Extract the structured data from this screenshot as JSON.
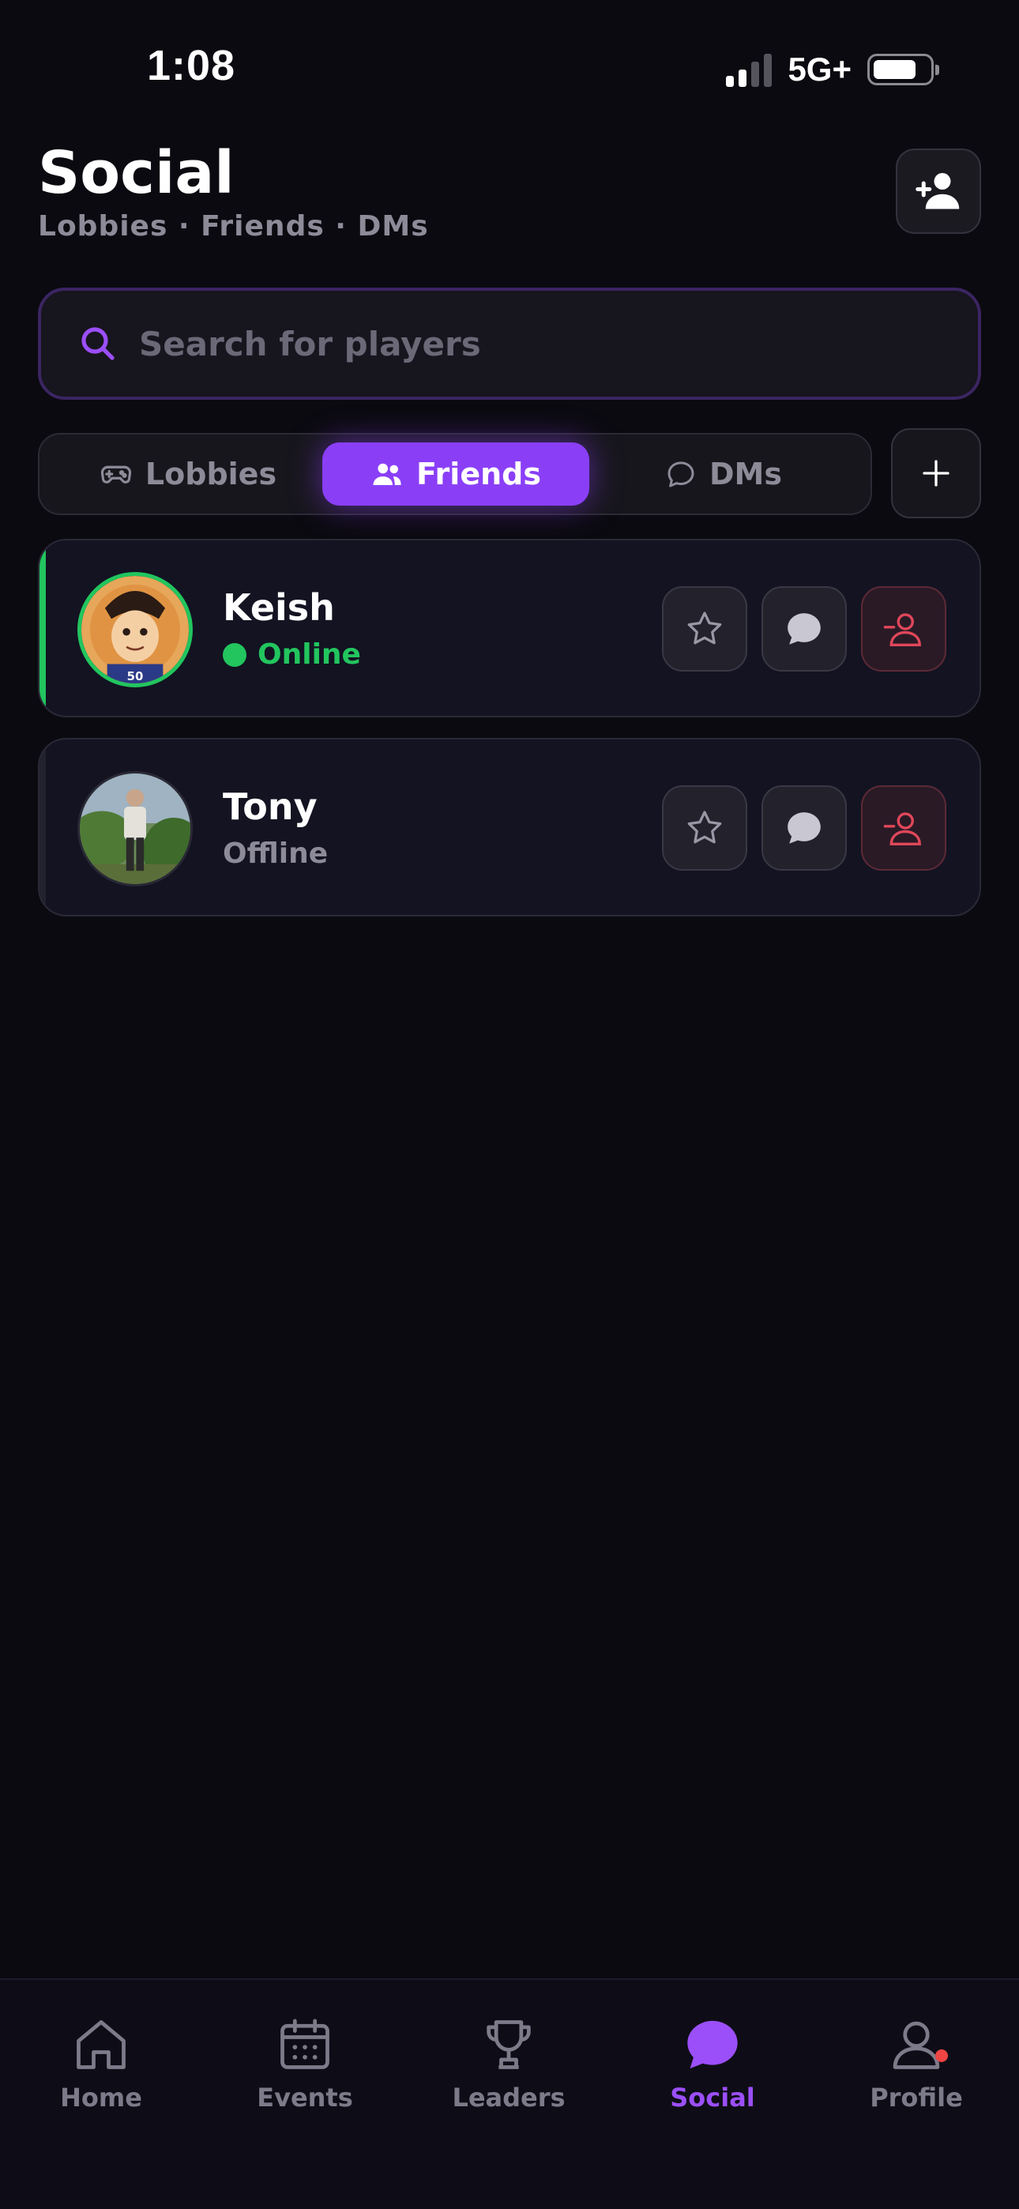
{
  "status_bar": {
    "time": "1:08",
    "network": "5G+",
    "battery_percent": 78
  },
  "header": {
    "title": "Social",
    "subtitle": "Lobbies · Friends · DMs",
    "add_friend_icon": "person-plus-icon"
  },
  "search": {
    "placeholder": "Search for players",
    "value": ""
  },
  "tabs": [
    {
      "label": "Lobbies",
      "icon": "gamepad-icon",
      "active": false
    },
    {
      "label": "Friends",
      "icon": "users-icon",
      "active": true
    },
    {
      "label": "DMs",
      "icon": "chat-bubble-icon",
      "active": false
    }
  ],
  "tab_add_icon": "plus-icon",
  "friends": [
    {
      "name": "Keish",
      "status": "Online",
      "status_color": "#22c55e",
      "online": true
    },
    {
      "name": "Tony",
      "status": "Offline",
      "status_color": "#8e8b99",
      "online": false
    }
  ],
  "friend_actions": [
    "star-icon",
    "message-icon",
    "remove-friend-icon"
  ],
  "nav": [
    {
      "label": "Home",
      "icon": "home-icon",
      "active": false
    },
    {
      "label": "Events",
      "icon": "calendar-icon",
      "active": false
    },
    {
      "label": "Leaders",
      "icon": "trophy-icon",
      "active": false
    },
    {
      "label": "Social",
      "icon": "chat-bubble-icon",
      "active": true
    },
    {
      "label": "Profile",
      "icon": "person-icon",
      "active": false,
      "has_notification": true
    }
  ],
  "colors": {
    "background": "#0b0a10",
    "accent": "#8a3ff7",
    "online": "#22c55e",
    "danger": "#ef4444"
  }
}
